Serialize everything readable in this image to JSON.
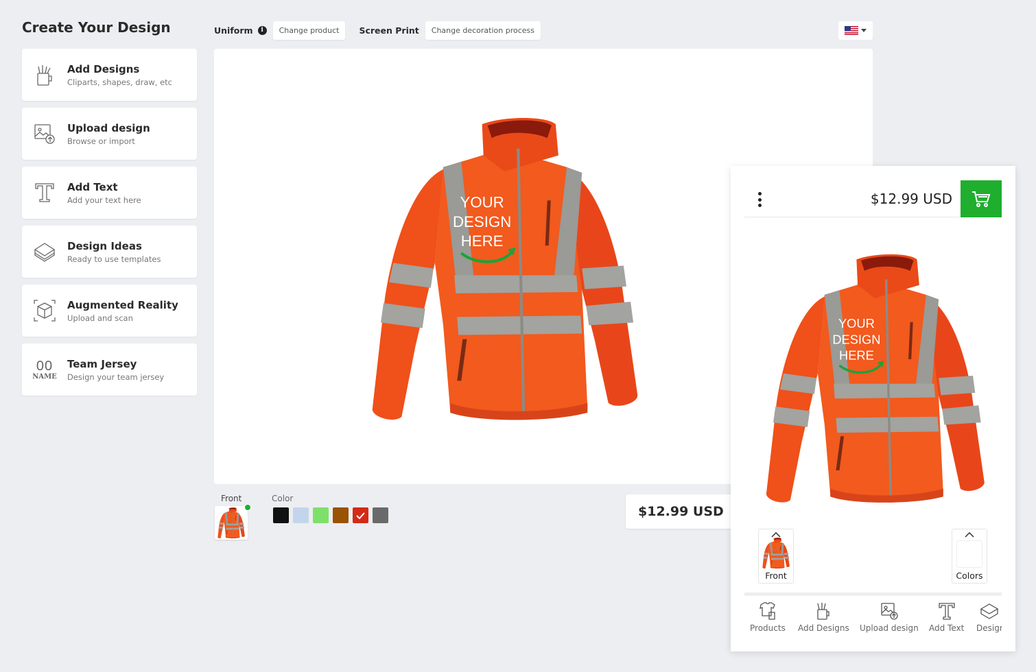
{
  "page": {
    "title": "Create Your Design"
  },
  "sidebar": {
    "items": [
      {
        "title": "Add Designs",
        "subtitle": "Cliparts, shapes, draw, etc",
        "icon": "add-designs-icon"
      },
      {
        "title": "Upload design",
        "subtitle": "Browse or import",
        "icon": "upload-icon"
      },
      {
        "title": "Add Text",
        "subtitle": "Add your text here",
        "icon": "text-icon"
      },
      {
        "title": "Design Ideas",
        "subtitle": "Ready to use templates",
        "icon": "design-ideas-icon"
      },
      {
        "title": "Augmented Reality",
        "subtitle": "Upload and scan",
        "icon": "ar-cube-icon"
      },
      {
        "title": "Team Jersey",
        "subtitle": "Design your team jersey",
        "icon": "team-jersey-icon",
        "icon_text": "NAME",
        "icon_number": "00"
      }
    ]
  },
  "toolbar": {
    "product_label": "Uniform",
    "info_glyph": "i",
    "change_product": "Change product",
    "process_label": "Screen Print",
    "change_process": "Change decoration process",
    "locale_flag": "us-flag-icon"
  },
  "canvas": {
    "design_text": [
      "YOUR",
      "DESIGN",
      "HERE"
    ]
  },
  "views": {
    "front_label": "Front"
  },
  "colors": {
    "label": "Color",
    "swatches": [
      "#111111",
      "#c3d5ea",
      "#7ee06b",
      "#9a5203",
      "#d42a17",
      "#6b6a6a"
    ],
    "selected_index": 4
  },
  "price": {
    "desktop": "$12.99 USD"
  },
  "mobile": {
    "price": "$12.99 USD",
    "design_text": [
      "YOUR",
      "DESIGN",
      "HERE"
    ],
    "front_label": "Front",
    "colors_label": "Colors",
    "nav": [
      {
        "label": "Products",
        "icon": "products-icon"
      },
      {
        "label": "Add Designs",
        "icon": "add-designs-icon"
      },
      {
        "label": "Upload design",
        "icon": "upload-icon"
      },
      {
        "label": "Add Text",
        "icon": "text-icon"
      },
      {
        "label": "Desigr",
        "icon": "design-ideas-icon"
      }
    ]
  },
  "accent": {
    "green": "#1fae2e",
    "jacket_orange": "#f2531c"
  }
}
